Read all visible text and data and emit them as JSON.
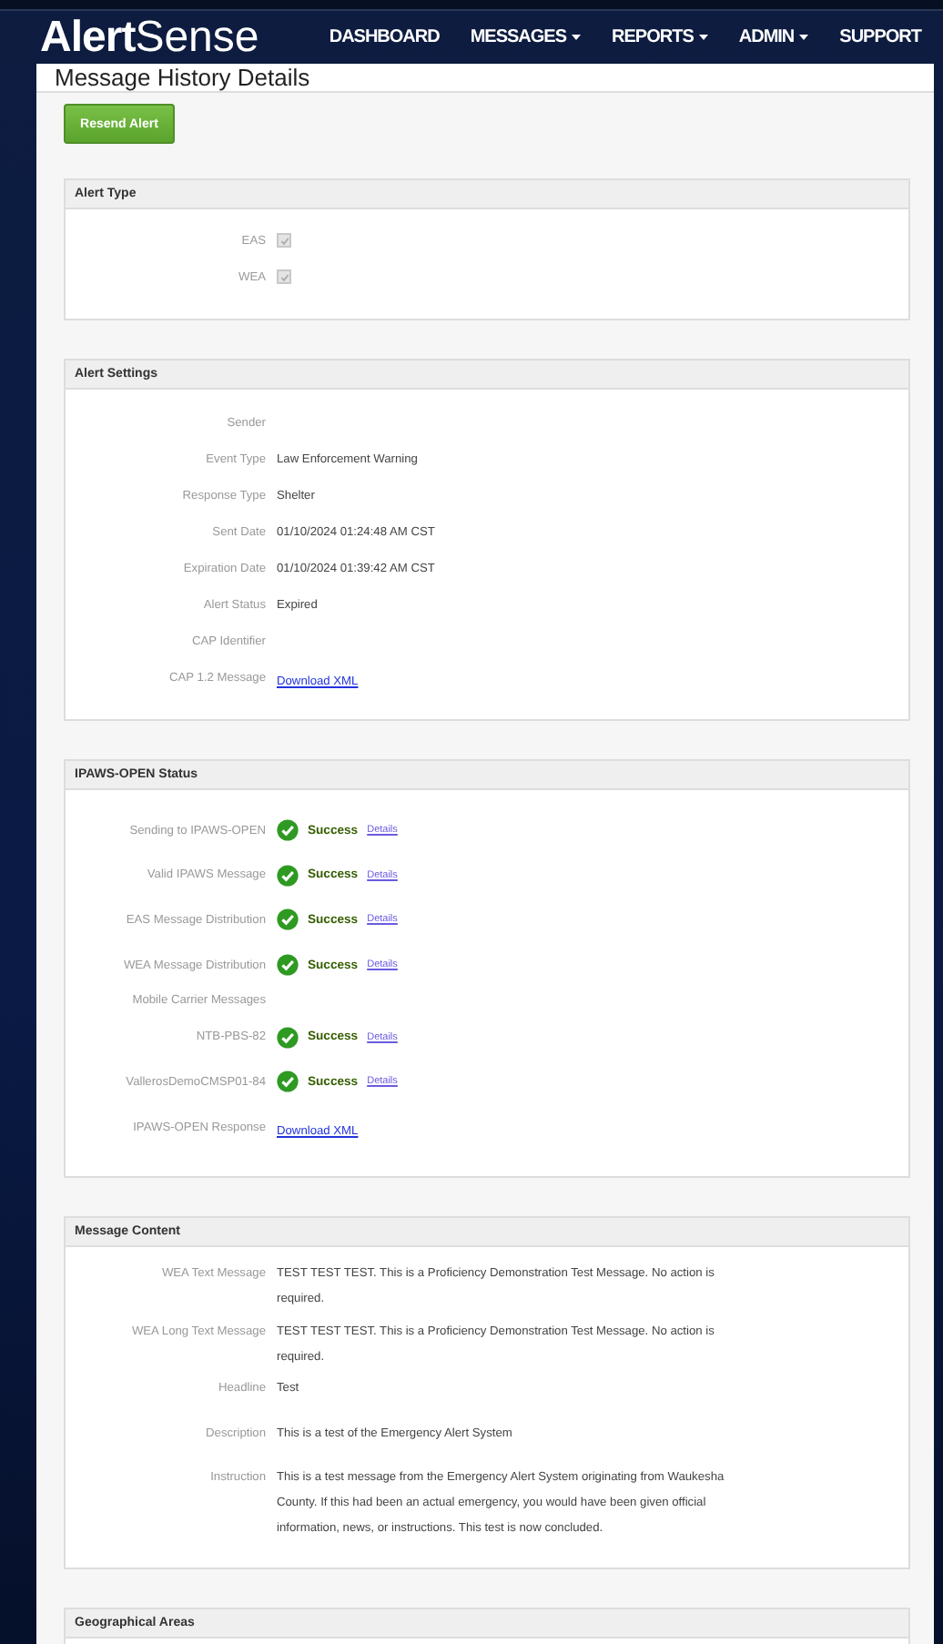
{
  "nav": {
    "logo": {
      "strong": "Alert",
      "light": "Sense"
    },
    "items": [
      {
        "label": "DASHBOARD",
        "dropdown": false
      },
      {
        "label": "MESSAGES",
        "dropdown": true
      },
      {
        "label": "REPORTS",
        "dropdown": true
      },
      {
        "label": "ADMIN",
        "dropdown": true
      },
      {
        "label": "SUPPORT",
        "dropdown": false
      }
    ]
  },
  "page_title": "Message History Details",
  "resend_button": "Resend Alert",
  "panels": [
    {
      "title": "Alert Type",
      "kind": "checkboxes",
      "rows": [
        {
          "label": "EAS",
          "checked": true
        },
        {
          "label": "WEA",
          "checked": true
        }
      ]
    },
    {
      "title": "Alert Settings",
      "kind": "fields",
      "rows": [
        {
          "label": "Sender"
        },
        {
          "label": "Event Type",
          "value": "Law Enforcement Warning"
        },
        {
          "label": "Response Type",
          "value": "Shelter"
        },
        {
          "label": "Sent Date",
          "value": "01/10/2024 01:24:48 AM CST"
        },
        {
          "label": "Expiration Date",
          "value": "01/10/2024 01:39:42 AM CST"
        },
        {
          "label": "Alert Status",
          "value": "Expired"
        },
        {
          "label": "CAP Identifier"
        },
        {
          "label": "CAP 1.2 Message",
          "link": "Download XML"
        }
      ]
    },
    {
      "title": "IPAWS-OPEN Status",
      "kind": "status",
      "rows": [
        {
          "kind": "status",
          "label": "Sending to IPAWS-OPEN",
          "status": "Success",
          "link": "Details"
        },
        {
          "kind": "status",
          "label": "Valid IPAWS Message",
          "status": "Success",
          "link": "Details"
        },
        {
          "kind": "status",
          "label": "EAS Message Distribution",
          "status": "Success",
          "link": "Details"
        },
        {
          "kind": "status",
          "label": "WEA Message Distribution",
          "status": "Success",
          "link": "Details"
        },
        {
          "kind": "heading",
          "label": "Mobile Carrier Messages"
        },
        {
          "kind": "status",
          "label": "NTB-PBS-82",
          "status": "Success",
          "link": "Details"
        },
        {
          "kind": "status",
          "label": "VallerosDemoCMSP01-84",
          "status": "Success",
          "link": "Details"
        },
        {
          "kind": "link",
          "label": "IPAWS-OPEN Response",
          "link": "Download XML"
        }
      ]
    },
    {
      "title": "Message Content",
      "kind": "content",
      "rows": [
        {
          "label": "WEA Text Message",
          "value": "TEST TEST TEST. This is a Proficiency Demonstration Test Message. No action is required."
        },
        {
          "label": "WEA Long Text Message",
          "value": "TEST TEST TEST. This is a Proficiency Demonstration Test Message. No action is required."
        },
        {
          "label": "Headline",
          "value": "Test"
        },
        {
          "label": "Description",
          "value": "This is a test of the Emergency Alert System"
        },
        {
          "label": "Instruction",
          "value": "This is a test message from the Emergency Alert System originating from Waukesha County. If this had been an actual emergency, you would have been given official information, news, or instructions. This test is now concluded."
        }
      ]
    },
    {
      "title": "Geographical Areas",
      "kind": "cut"
    }
  ]
}
